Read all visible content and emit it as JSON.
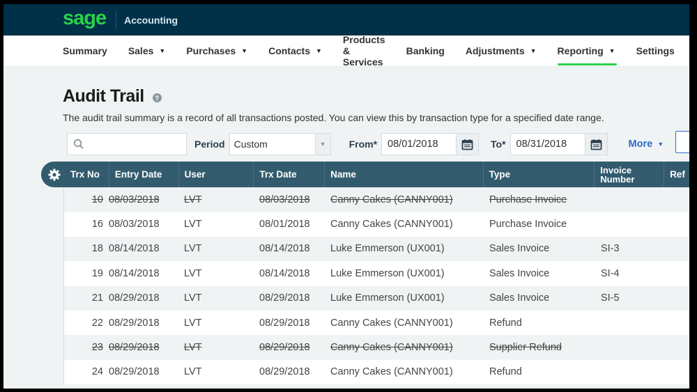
{
  "header": {
    "logo": "sage",
    "app_name": "Accounting"
  },
  "nav": {
    "items": [
      {
        "label": "Summary",
        "has_dropdown": false
      },
      {
        "label": "Sales",
        "has_dropdown": true
      },
      {
        "label": "Purchases",
        "has_dropdown": true
      },
      {
        "label": "Contacts",
        "has_dropdown": true
      },
      {
        "label": "Products & Services",
        "has_dropdown": false
      },
      {
        "label": "Banking",
        "has_dropdown": false
      },
      {
        "label": "Adjustments",
        "has_dropdown": true
      },
      {
        "label": "Reporting",
        "has_dropdown": true,
        "active": true
      },
      {
        "label": "Settings",
        "has_dropdown": false
      }
    ],
    "caret": "▼"
  },
  "page": {
    "title": "Audit Trail",
    "help_icon": "?",
    "description": "The audit trail summary is a record of all transactions posted. You can view this by transaction type for a specified date range."
  },
  "filters": {
    "search": {
      "value": "",
      "placeholder": ""
    },
    "period_label": "Period",
    "period_value": "Custom",
    "from_label": "From*",
    "from_value": "08/01/2018",
    "to_label": "To*",
    "to_value": "08/31/2018",
    "more_label": "More"
  },
  "table": {
    "columns": [
      "Trx No",
      "Entry Date",
      "User",
      "Trx Date",
      "Name",
      "Type",
      "Invoice Number",
      "Ref"
    ],
    "rows": [
      {
        "trx_no": "10",
        "entry_date": "08/03/2018",
        "user": "LVT",
        "trx_date": "08/03/2018",
        "name": "Canny Cakes (CANNY001)",
        "type": "Purchase Invoice",
        "invoice": "",
        "ref": "",
        "voided": true
      },
      {
        "trx_no": "16",
        "entry_date": "08/03/2018",
        "user": "LVT",
        "trx_date": "08/01/2018",
        "name": "Canny Cakes (CANNY001)",
        "type": "Purchase Invoice",
        "invoice": "",
        "ref": "",
        "voided": false
      },
      {
        "trx_no": "18",
        "entry_date": "08/14/2018",
        "user": "LVT",
        "trx_date": "08/14/2018",
        "name": "Luke Emmerson (UX001)",
        "type": "Sales Invoice",
        "invoice": "SI-3",
        "ref": "",
        "voided": false
      },
      {
        "trx_no": "19",
        "entry_date": "08/14/2018",
        "user": "LVT",
        "trx_date": "08/14/2018",
        "name": "Luke Emmerson (UX001)",
        "type": "Sales Invoice",
        "invoice": "SI-4",
        "ref": "",
        "voided": false
      },
      {
        "trx_no": "21",
        "entry_date": "08/29/2018",
        "user": "LVT",
        "trx_date": "08/29/2018",
        "name": "Luke Emmerson (UX001)",
        "type": "Sales Invoice",
        "invoice": "SI-5",
        "ref": "",
        "voided": false
      },
      {
        "trx_no": "22",
        "entry_date": "08/29/2018",
        "user": "LVT",
        "trx_date": "08/29/2018",
        "name": "Canny Cakes (CANNY001)",
        "type": "Refund",
        "invoice": "",
        "ref": "",
        "voided": false
      },
      {
        "trx_no": "23",
        "entry_date": "08/29/2018",
        "user": "LVT",
        "trx_date": "08/29/2018",
        "name": "Canny Cakes (CANNY001)",
        "type": "Supplier Refund",
        "invoice": "",
        "ref": "",
        "voided": true
      },
      {
        "trx_no": "24",
        "entry_date": "08/29/2018",
        "user": "LVT",
        "trx_date": "08/29/2018",
        "name": "Canny Cakes (CANNY001)",
        "type": "Refund",
        "invoice": "",
        "ref": "",
        "voided": false
      }
    ]
  },
  "colors": {
    "topbar": "#003149",
    "brand_green": "#29d14a",
    "table_header": "#335b6e",
    "link_blue": "#2e6bc6"
  }
}
